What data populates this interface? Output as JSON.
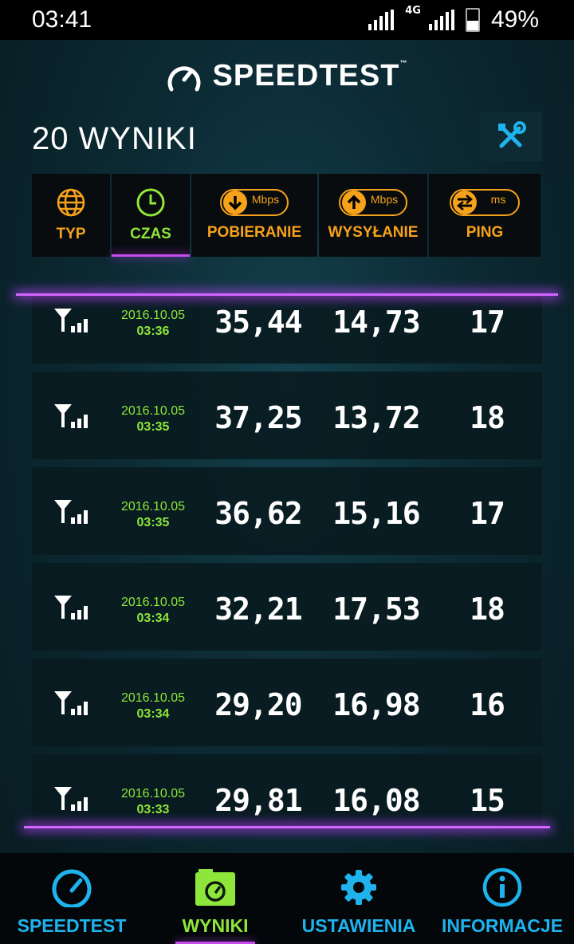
{
  "status_bar": {
    "time": "03:41",
    "network": "4G",
    "battery": "49%"
  },
  "brand": {
    "name": "SPEEDTEST",
    "tm": "™"
  },
  "results_count": "20 WYNIKI",
  "table_header": {
    "type": "TYP",
    "time": "CZAS",
    "download": "POBIERANIE",
    "download_unit": "Mbps",
    "upload": "WYSYŁANIE",
    "upload_unit": "Mbps",
    "ping": "PING",
    "ping_unit": "ms"
  },
  "results": [
    {
      "date": "2016.10.05",
      "time": "03:36",
      "download": "35,44",
      "upload": "14,73",
      "ping": "17"
    },
    {
      "date": "2016.10.05",
      "time": "03:35",
      "download": "37,25",
      "upload": "13,72",
      "ping": "18"
    },
    {
      "date": "2016.10.05",
      "time": "03:35",
      "download": "36,62",
      "upload": "15,16",
      "ping": "17"
    },
    {
      "date": "2016.10.05",
      "time": "03:34",
      "download": "32,21",
      "upload": "17,53",
      "ping": "18"
    },
    {
      "date": "2016.10.05",
      "time": "03:34",
      "download": "29,20",
      "upload": "16,98",
      "ping": "16"
    },
    {
      "date": "2016.10.05",
      "time": "03:33",
      "download": "29,81",
      "upload": "16,08",
      "ping": "15"
    }
  ],
  "bottom_nav": {
    "speedtest": "SPEEDTEST",
    "results": "WYNIKI",
    "settings": "USTAWIENIA",
    "info": "INFORMACJE"
  },
  "colors": {
    "accent_orange": "#f7a21b",
    "accent_green": "#8fe63a",
    "accent_blue": "#1fb3ee",
    "glow_purple": "#c84bf0"
  }
}
